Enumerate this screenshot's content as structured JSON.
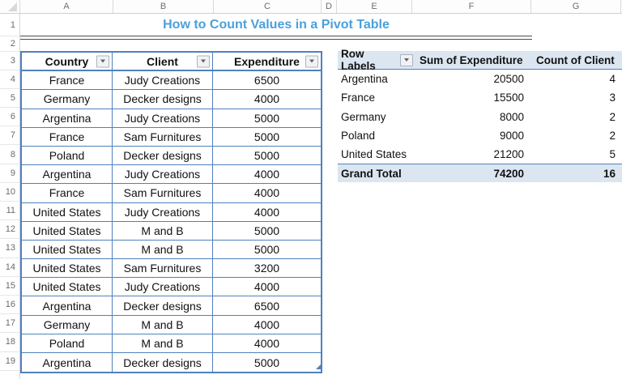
{
  "title": "How to Count Values in a Pivot Table",
  "colors": {
    "title_blue": "#4BA0DC",
    "tbl_border": "#4F81BD",
    "pivot_fill": "#DCE6F1",
    "pivot_line": "#4F81BD",
    "dbl_line": "#4d4d4d"
  },
  "column_letters": [
    "A",
    "B",
    "C",
    "D",
    "E",
    "F",
    "G"
  ],
  "row_numbers": [
    "1",
    "2",
    "3",
    "4",
    "5",
    "6",
    "7",
    "8",
    "9",
    "10",
    "11",
    "12",
    "13",
    "14",
    "15",
    "16",
    "17",
    "18",
    "19"
  ],
  "data_table": {
    "headers": [
      "Country",
      "Client",
      "Expenditure"
    ],
    "rows": [
      [
        "France",
        "Judy Creations",
        "6500"
      ],
      [
        "Germany",
        "Decker designs",
        "4000"
      ],
      [
        "Argentina",
        "Judy Creations",
        "5000"
      ],
      [
        "France",
        "Sam Furnitures",
        "5000"
      ],
      [
        "Poland",
        "Decker designs",
        "5000"
      ],
      [
        "Argentina",
        "Judy Creations",
        "4000"
      ],
      [
        "France",
        "Sam Furnitures",
        "4000"
      ],
      [
        "United States",
        "Judy Creations",
        "4000"
      ],
      [
        "United States",
        "M and B",
        "5000"
      ],
      [
        "United States",
        "M and B",
        "5000"
      ],
      [
        "United States",
        "Sam Furnitures",
        "3200"
      ],
      [
        "United States",
        "Judy Creations",
        "4000"
      ],
      [
        "Argentina",
        "Decker designs",
        "6500"
      ],
      [
        "Germany",
        "M and B",
        "4000"
      ],
      [
        "Poland",
        "M and B",
        "4000"
      ],
      [
        "Argentina",
        "Decker designs",
        "5000"
      ]
    ]
  },
  "pivot_table": {
    "headers": [
      "Row Labels",
      "Sum of Expenditure",
      "Count of Client"
    ],
    "rows": [
      [
        "Argentina",
        "20500",
        "4"
      ],
      [
        "France",
        "15500",
        "3"
      ],
      [
        "Germany",
        "8000",
        "2"
      ],
      [
        "Poland",
        "9000",
        "2"
      ],
      [
        "United States",
        "21200",
        "5"
      ]
    ],
    "grand_total": [
      "Grand Total",
      "74200",
      "16"
    ]
  }
}
